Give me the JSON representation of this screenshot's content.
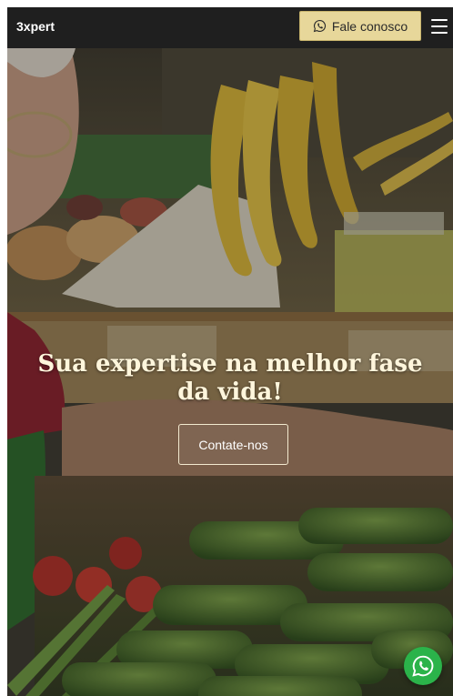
{
  "header": {
    "brand": "3xpert",
    "cta_label": "Fale conosco",
    "cta_icon": "whatsapp-icon",
    "menu_icon": "hamburger-menu-icon"
  },
  "hero": {
    "headline": "Sua expertise na melhor fase da vida!",
    "button_label": "Contate-nos"
  },
  "floating": {
    "icon": "whatsapp-icon"
  },
  "colors": {
    "header_bg": "#1f1f1f",
    "cta_bg": "#e7d79a",
    "headline_text": "#fff6dc",
    "whatsapp_green": "#2bb34a"
  }
}
